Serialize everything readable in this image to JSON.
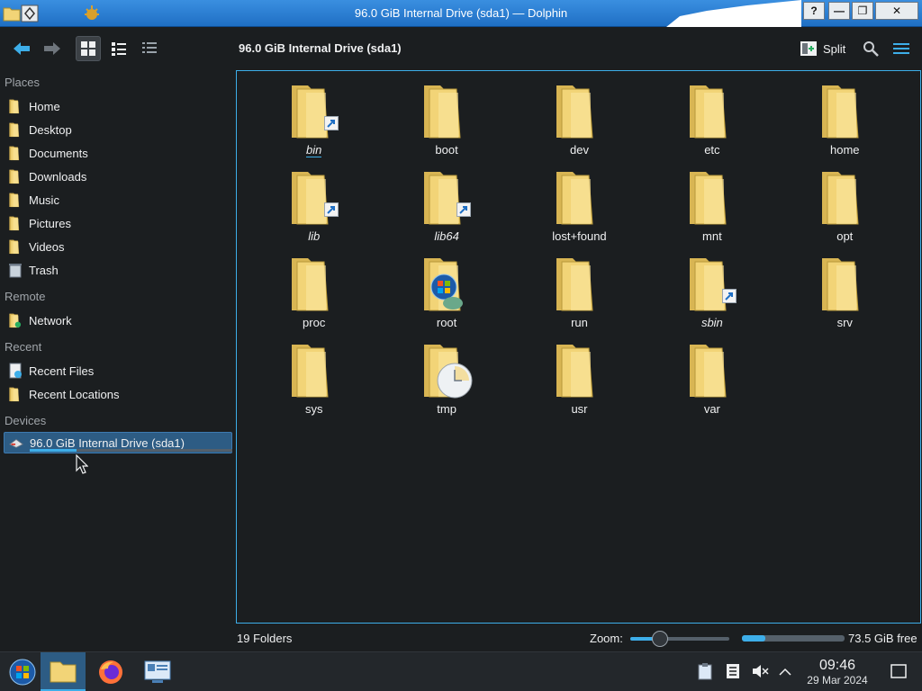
{
  "window": {
    "title": "96.0 GiB Internal Drive (sda1) — Dolphin",
    "help_label": "?"
  },
  "toolbar": {
    "location": "96.0 GiB Internal Drive (sda1)",
    "split_label": "Split"
  },
  "sidebar": {
    "places_header": "Places",
    "places": [
      {
        "label": "Home",
        "icon": "home-folder-icon"
      },
      {
        "label": "Desktop",
        "icon": "desktop-folder-icon"
      },
      {
        "label": "Documents",
        "icon": "documents-folder-icon"
      },
      {
        "label": "Downloads",
        "icon": "downloads-folder-icon"
      },
      {
        "label": "Music",
        "icon": "music-folder-icon"
      },
      {
        "label": "Pictures",
        "icon": "pictures-folder-icon"
      },
      {
        "label": "Videos",
        "icon": "videos-folder-icon"
      },
      {
        "label": "Trash",
        "icon": "trash-icon"
      }
    ],
    "remote_header": "Remote",
    "remote": [
      {
        "label": "Network",
        "icon": "network-icon"
      }
    ],
    "recent_header": "Recent",
    "recent": [
      {
        "label": "Recent Files",
        "icon": "recent-files-icon"
      },
      {
        "label": "Recent Locations",
        "icon": "recent-locations-icon"
      }
    ],
    "devices_header": "Devices",
    "devices": [
      {
        "label": "96.0 GiB Internal Drive (sda1)",
        "icon": "drive-icon",
        "usage_fraction": 0.23
      }
    ]
  },
  "folders": [
    {
      "name": "bin",
      "link": true,
      "italic": true
    },
    {
      "name": "boot",
      "link": false,
      "italic": false
    },
    {
      "name": "dev",
      "link": false,
      "italic": false
    },
    {
      "name": "etc",
      "link": false,
      "italic": false
    },
    {
      "name": "home",
      "link": false,
      "italic": false
    },
    {
      "name": "lib",
      "link": true,
      "italic": true
    },
    {
      "name": "lib64",
      "link": true,
      "italic": true
    },
    {
      "name": "lost+found",
      "link": false,
      "italic": false
    },
    {
      "name": "mnt",
      "link": false,
      "italic": false
    },
    {
      "name": "opt",
      "link": false,
      "italic": false
    },
    {
      "name": "proc",
      "link": false,
      "italic": false
    },
    {
      "name": "root",
      "link": false,
      "italic": false,
      "overlay": "user-overlay-icon"
    },
    {
      "name": "run",
      "link": false,
      "italic": false
    },
    {
      "name": "sbin",
      "link": true,
      "italic": true
    },
    {
      "name": "srv",
      "link": false,
      "italic": false
    },
    {
      "name": "sys",
      "link": false,
      "italic": false
    },
    {
      "name": "tmp",
      "link": false,
      "italic": false,
      "overlay": "clock-overlay-icon"
    },
    {
      "name": "usr",
      "link": false,
      "italic": false
    },
    {
      "name": "var",
      "link": false,
      "italic": false
    }
  ],
  "statusbar": {
    "count": "19 Folders",
    "zoom_label": "Zoom:",
    "zoom_fraction": 0.3,
    "free_label": "73.5 GiB free",
    "used_fraction": 0.23
  },
  "taskbar": {
    "time": "09:46",
    "date": "29 Mar 2024"
  },
  "colors": {
    "accent": "#3daee9",
    "folder": "#f2d477",
    "background": "#1b1e20"
  }
}
